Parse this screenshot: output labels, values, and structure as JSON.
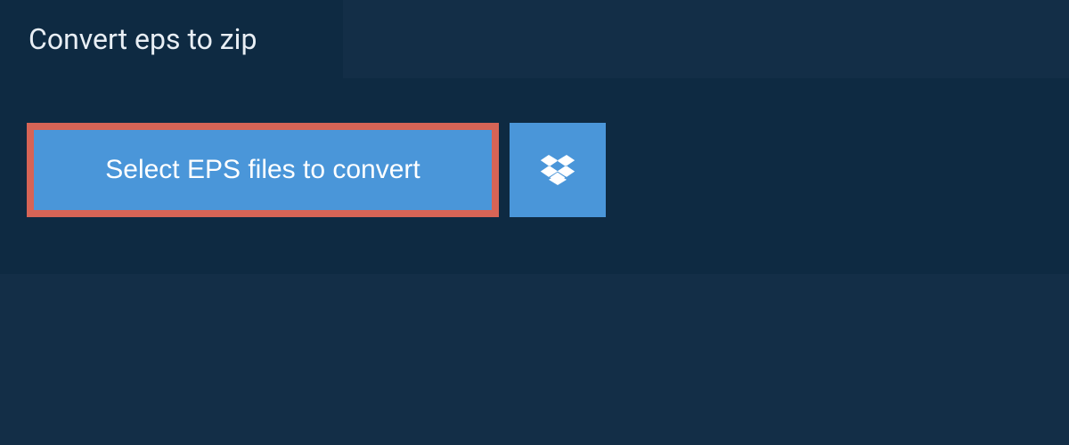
{
  "tab": {
    "label": "Convert eps to zip"
  },
  "actions": {
    "select_label": "Select EPS files to convert"
  },
  "colors": {
    "accent": "#4a96d9",
    "highlight_border": "#d66456",
    "bg_dark": "#0e2a42",
    "bg_light": "#132e47"
  }
}
